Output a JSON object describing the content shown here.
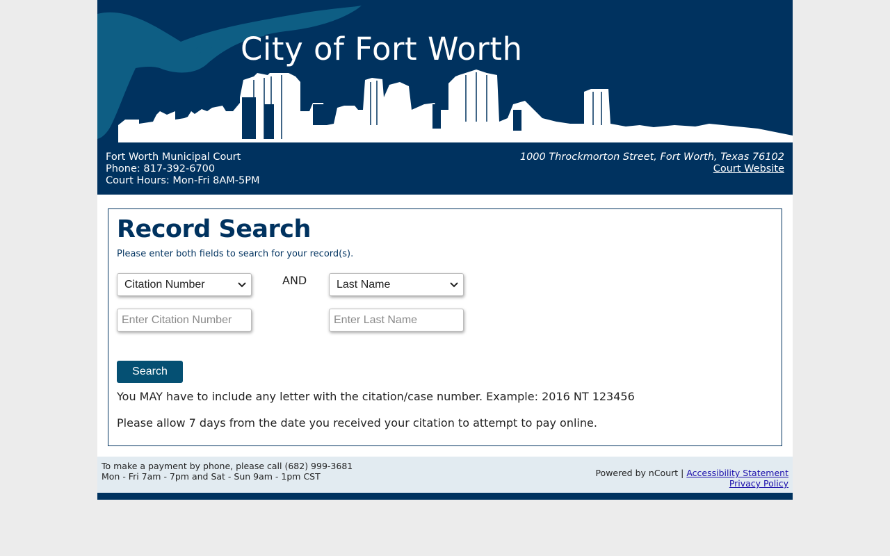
{
  "banner": {
    "title": "City of Fort Worth"
  },
  "court_info": {
    "name": "Fort Worth Municipal Court",
    "phone": "Phone: 817-392-6700",
    "hours": "Court Hours: Mon-Fri 8AM-5PM",
    "address": "1000 Throckmorton Street, Fort Worth, Texas 76102",
    "website_link": "Court Website"
  },
  "search": {
    "heading": "Record Search",
    "hint": "Please enter both fields to search for your record(s).",
    "first_field_type": "Citation Number",
    "and_label": "AND",
    "second_field_type": "Last Name",
    "citation_placeholder": "Enter Citation Number",
    "lastname_placeholder": "Enter Last Name",
    "button_label": "Search",
    "note_letter": "You MAY have to include any letter with the citation/case number. Example: 2016 NT 123456",
    "note_days": "Please allow 7 days from the date you received your citation to attempt to pay online."
  },
  "footer": {
    "phone_line": "To make a payment by phone, please call (682) 999-3681",
    "hours_line": "Mon - Fri 7am - 7pm and Sat - Sun 9am - 1pm CST",
    "powered_by": "Powered by nCourt |",
    "accessibility_link": "Accessibility Statement",
    "privacy_link": "Privacy Policy"
  },
  "colors": {
    "brand_navy": "#00325f",
    "button_teal": "#055073",
    "footer_bg": "#e2ebf1",
    "page_bg": "#ececec"
  },
  "icons": [
    "longhorn-logo",
    "skyline-silhouette",
    "chevron-down-icon"
  ]
}
